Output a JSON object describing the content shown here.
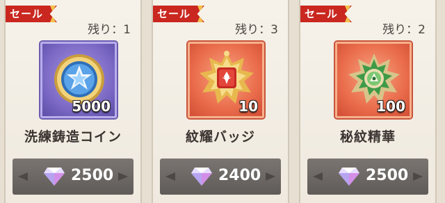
{
  "items": [
    {
      "sale_label": "セール",
      "remaining": "残り：1",
      "quantity": "5000",
      "name": "洗練鋳造コイン",
      "price": "2500",
      "icon": "star-coin-icon",
      "frame_color": "#7a68c4"
    },
    {
      "sale_label": "セール",
      "remaining": "残り：3",
      "quantity": "10",
      "name": "紋耀バッジ",
      "price": "2400",
      "icon": "gold-badge-icon",
      "frame_color": "#ea6d4c"
    },
    {
      "sale_label": "セール",
      "remaining": "残り：2",
      "quantity": "100",
      "name": "秘紋精華",
      "price": "2500",
      "icon": "green-emblem-icon",
      "frame_color": "#ea6d4c"
    }
  ],
  "colors": {
    "sale_tag": "#c9271f",
    "price_bar": "#6a6562"
  }
}
